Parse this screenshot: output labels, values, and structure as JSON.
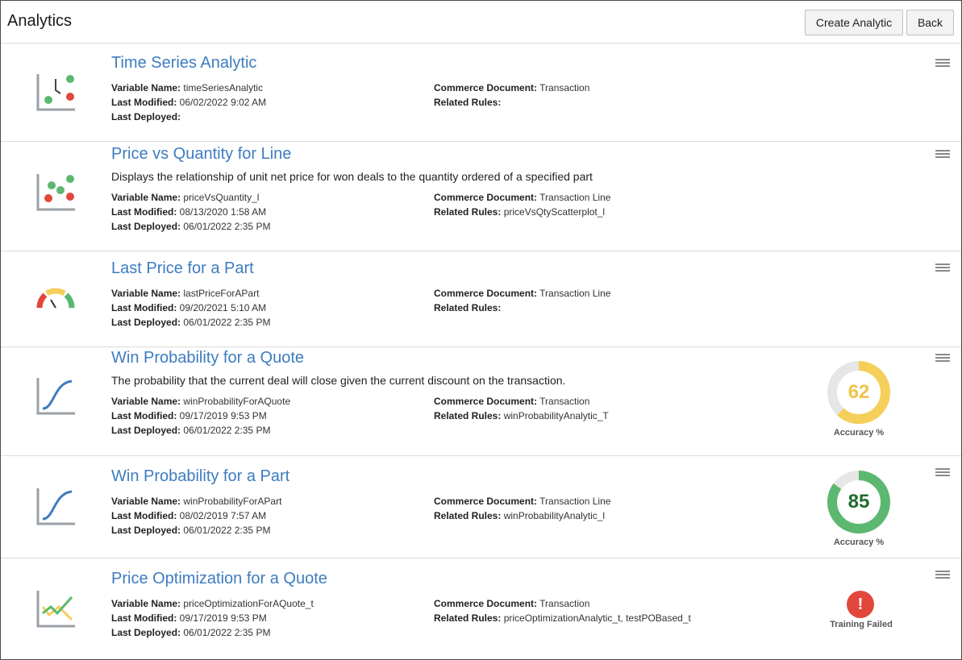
{
  "header": {
    "title": "Analytics",
    "create_label": "Create Analytic",
    "back_label": "Back"
  },
  "labels": {
    "variable_name": "Variable Name:",
    "last_modified": "Last Modified:",
    "last_deployed": "Last Deployed:",
    "commerce_document": "Commerce Document:",
    "related_rules": "Related Rules:"
  },
  "colors": {
    "link": "#3d7cc0",
    "accent_yellow": "#f5cf5a",
    "accent_green": "#5cb870",
    "error_red": "#e2473c",
    "icon_gray": "#9aa0a6"
  },
  "analytics": [
    {
      "title": "Time Series Analytic",
      "description": "",
      "icon": "time-series-chart-icon",
      "variable_name": "timeSeriesAnalytic",
      "last_modified": "06/02/2022 9:02 AM",
      "last_deployed": "",
      "commerce_document": "Transaction",
      "related_rules": ""
    },
    {
      "title": "Price vs Quantity for Line",
      "description": "Displays the relationship of unit net price for won deals to the quantity ordered of a specified part",
      "icon": "scatter-chart-icon",
      "variable_name": "priceVsQuantity_l",
      "last_modified": "08/13/2020 1:58 AM",
      "last_deployed": "06/01/2022 2:35 PM",
      "commerce_document": "Transaction Line",
      "related_rules": "priceVsQtyScatterplot_l"
    },
    {
      "title": "Last Price for a Part",
      "description": "",
      "icon": "gauge-icon",
      "variable_name": "lastPriceForAPart",
      "last_modified": "09/20/2021 5:10 AM",
      "last_deployed": "06/01/2022 2:35 PM",
      "commerce_document": "Transaction Line",
      "related_rules": ""
    },
    {
      "title": "Win Probability for a Quote",
      "description": "The probability that the current deal will close given the current discount on the transaction.",
      "icon": "s-curve-chart-icon",
      "variable_name": "winProbabilityForAQuote",
      "last_modified": "09/17/2019 9:53 PM",
      "last_deployed": "06/01/2022 2:35 PM",
      "commerce_document": "Transaction",
      "related_rules": "winProbabilityAnalytic_T",
      "accuracy": "62",
      "accuracy_fraction": 0.62,
      "accuracy_color": "#f5cf5a",
      "accuracy_text_color": "#f0c348",
      "accuracy_label": "Accuracy %"
    },
    {
      "title": "Win Probability for a Part",
      "description": "",
      "icon": "s-curve-chart-icon",
      "variable_name": "winProbabilityForAPart",
      "last_modified": "08/02/2019 7:57 AM",
      "last_deployed": "06/01/2022 2:35 PM",
      "commerce_document": "Transaction Line",
      "related_rules": "winProbabilityAnalytic_l",
      "accuracy": "85",
      "accuracy_fraction": 0.85,
      "accuracy_color": "#5cb870",
      "accuracy_text_color": "#1f6b2c",
      "accuracy_label": "Accuracy %"
    },
    {
      "title": "Price Optimization for a Quote",
      "description": "",
      "icon": "line-chart-icon",
      "variable_name": "priceOptimizationForAQuote_t",
      "last_modified": "09/17/2019 9:53 PM",
      "last_deployed": "06/01/2022 2:35 PM",
      "commerce_document": "Transaction",
      "related_rules": "priceOptimizationAnalytic_t, testPOBased_t",
      "status": "Training Failed",
      "status_icon": "!"
    }
  ]
}
